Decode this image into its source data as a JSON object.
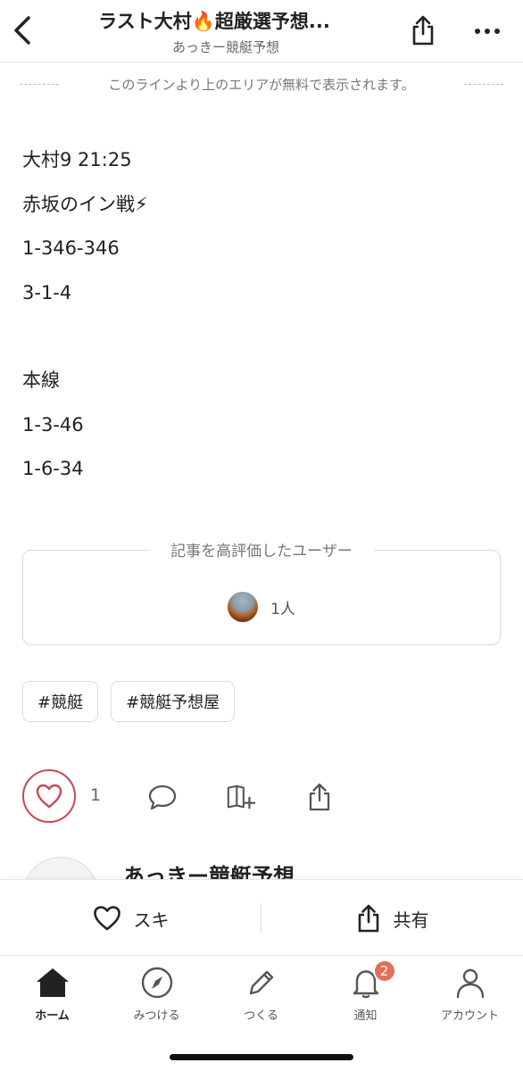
{
  "header": {
    "title": "ラスト大村🔥超厳選予想...",
    "subtitle": "あっきー競艇予想"
  },
  "free_notice": "このラインより上のエリアが無料で表示されます。",
  "body_lines": [
    "大村9  21:25",
    "赤坂のイン戦⚡",
    "1-346-346",
    "3-1-4",
    "",
    "本線",
    "1-3-46",
    "1-6-34"
  ],
  "liked": {
    "title": "記事を高評価したユーザー",
    "count": "1人"
  },
  "tags": [
    "#競艇",
    "#競艇予想屋"
  ],
  "actions": {
    "like_count": "1",
    "like_color": "#c84a55"
  },
  "author": {
    "name": "あっきー競艇予想"
  },
  "sticky": {
    "like_label": "スキ",
    "share_label": "共有"
  },
  "tabs": [
    {
      "label": "ホーム",
      "icon": "home-icon"
    },
    {
      "label": "みつける",
      "icon": "compass-icon"
    },
    {
      "label": "つくる",
      "icon": "pencil-icon"
    },
    {
      "label": "通知",
      "icon": "bell-icon",
      "badge": "2"
    },
    {
      "label": "アカウント",
      "icon": "user-icon"
    }
  ],
  "colors": {
    "badge": "#e0705a",
    "accent": "#c84a55"
  }
}
